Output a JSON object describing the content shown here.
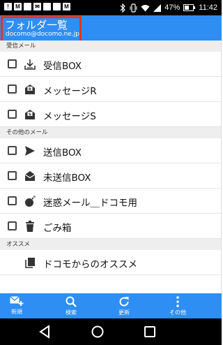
{
  "status_bar": {
    "left_icons": [
      "!",
      "M",
      "",
      "✉",
      "",
      "",
      "M"
    ],
    "battery": "47%",
    "time": "11:42"
  },
  "header": {
    "title": "フォルダ一覧",
    "account": "docomo@docomo.ne.jp"
  },
  "sections": [
    {
      "title": "受信メール",
      "items": [
        {
          "label": "受信BOX",
          "icon": "inbox-download-icon"
        },
        {
          "label": "メッセージR",
          "icon": "envelope-r-icon"
        },
        {
          "label": "メッセージS",
          "icon": "envelope-s-icon"
        }
      ]
    },
    {
      "title": "その他のメール",
      "items": [
        {
          "label": "送信BOX",
          "icon": "send-icon"
        },
        {
          "label": "未送信BOX",
          "icon": "envelope-open-icon"
        },
        {
          "label": "迷惑メール＿ドコモ用",
          "icon": "bomb-icon"
        },
        {
          "label": "ごみ箱",
          "icon": "trash-icon"
        }
      ]
    },
    {
      "title": "オススメ",
      "items": [
        {
          "label": "ドコモからのオススメ",
          "icon": "copy-icon"
        }
      ]
    }
  ],
  "toolbar": {
    "new_label": "新規",
    "search_label": "検索",
    "refresh_label": "更新",
    "other_label": "その他"
  },
  "colors": {
    "accent": "#2e8ef4",
    "highlight_box": "#e8321e",
    "section_bg": "#eeeeee"
  }
}
